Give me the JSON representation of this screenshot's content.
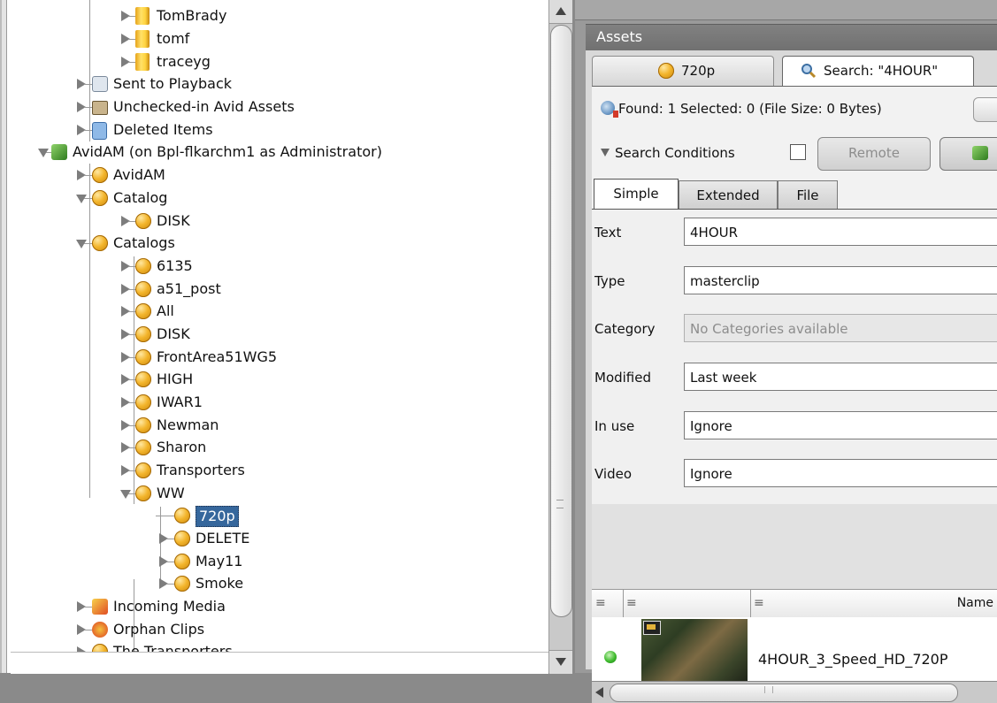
{
  "tree": {
    "items": [
      {
        "label": "TomBrady",
        "icon": "folder-icon"
      },
      {
        "label": "tomf",
        "icon": "folder-icon"
      },
      {
        "label": "traceyg",
        "icon": "folder-icon"
      },
      {
        "label": "Sent to Playback",
        "icon": "playback-icon"
      },
      {
        "label": "Unchecked-in Avid Assets",
        "icon": "toolbox-icon"
      },
      {
        "label": "Deleted Items",
        "icon": "trash-icon"
      },
      {
        "label": "AvidAM (on Bpl-flkarchm1 as Administrator)",
        "icon": "server-icon"
      },
      {
        "label": "AvidAM",
        "icon": "database-icon"
      },
      {
        "label": "Catalog",
        "icon": "database-icon"
      },
      {
        "label": "DISK",
        "icon": "database-icon"
      },
      {
        "label": "Catalogs",
        "icon": "database-icon"
      },
      {
        "label": "6135",
        "icon": "database-icon"
      },
      {
        "label": "a51_post",
        "icon": "database-icon"
      },
      {
        "label": "All",
        "icon": "database-icon"
      },
      {
        "label": "DISK",
        "icon": "database-icon"
      },
      {
        "label": "FrontArea51WG5",
        "icon": "database-icon"
      },
      {
        "label": "HIGH",
        "icon": "database-icon"
      },
      {
        "label": "IWAR1",
        "icon": "database-icon"
      },
      {
        "label": "Newman",
        "icon": "database-icon"
      },
      {
        "label": "Sharon",
        "icon": "database-icon"
      },
      {
        "label": "Transporters",
        "icon": "database-icon"
      },
      {
        "label": "WW",
        "icon": "database-icon"
      },
      {
        "label": "720p",
        "icon": "database-icon",
        "selected": true
      },
      {
        "label": "DELETE",
        "icon": "database-icon"
      },
      {
        "label": "May11",
        "icon": "database-icon"
      },
      {
        "label": "Smoke",
        "icon": "database-icon"
      },
      {
        "label": "Incoming Media",
        "icon": "incoming-icon"
      },
      {
        "label": "Orphan Clips",
        "icon": "orphan-icon"
      },
      {
        "label": "The Transporters",
        "icon": "database-icon"
      }
    ]
  },
  "assets": {
    "title": "Assets",
    "tabs": [
      {
        "label": "720p",
        "icon": "database-icon"
      },
      {
        "label": "Search: \"4HOUR\"",
        "icon": "search-icon",
        "active": true
      }
    ],
    "found_text": "Found: 1 Selected: 0 (File Size: 0 Bytes)",
    "search_conditions_label": "Search Conditions",
    "remote_label": "Remote",
    "subtabs": [
      "Simple",
      "Extended",
      "File"
    ],
    "fields": [
      {
        "label": "Text",
        "value": "4HOUR"
      },
      {
        "label": "Type",
        "value": "masterclip"
      },
      {
        "label": "Category",
        "value": "No Categories available",
        "disabled": true
      },
      {
        "label": "Modified",
        "value": "Last week"
      },
      {
        "label": "In use",
        "value": "Ignore"
      },
      {
        "label": "Video",
        "value": "Ignore"
      }
    ],
    "table": {
      "columns": [
        "",
        "",
        "Name"
      ],
      "rows": [
        {
          "name": "4HOUR_3_Speed_HD_720P",
          "status": "online"
        }
      ]
    }
  },
  "colors": {
    "selection": "#36679c",
    "title_bar": "#707070",
    "status_online": "#3fbb2e"
  }
}
